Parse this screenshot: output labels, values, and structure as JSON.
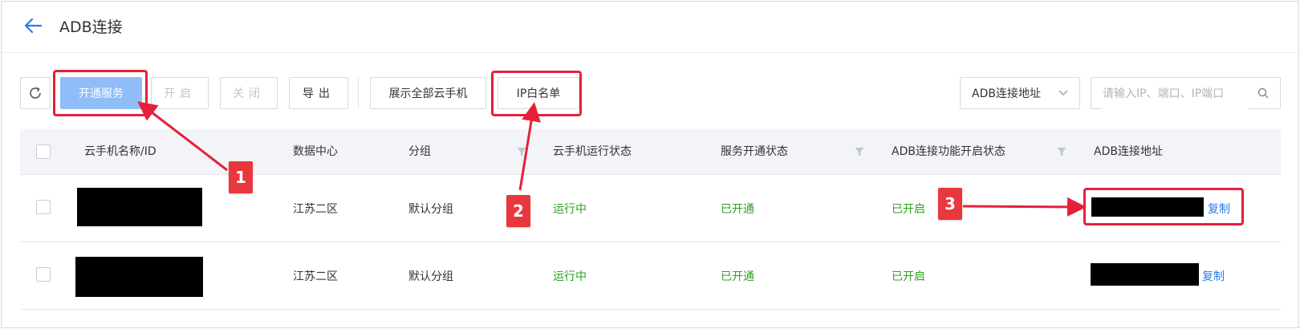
{
  "header": {
    "title": "ADB连接"
  },
  "toolbar": {
    "open_service": "开通服务",
    "enable": "开启",
    "close": "关闭",
    "export": "导出",
    "show_all": "展示全部云手机",
    "ip_whitelist": "IP白名单"
  },
  "filter": {
    "selected": "ADB连接地址"
  },
  "search": {
    "placeholder": "请输入IP、端口、IP端口"
  },
  "table": {
    "columns": {
      "name": "云手机名称/ID",
      "datacenter": "数据中心",
      "group": "分组",
      "run_status": "云手机运行状态",
      "service_status": "服务开通状态",
      "adb_status": "ADB连接功能开启状态",
      "adb_address": "ADB连接地址"
    },
    "rows": [
      {
        "datacenter": "江苏二区",
        "group": "默认分组",
        "run_status": "运行中",
        "service_status": "已开通",
        "adb_status": "已开启",
        "copy": "复制"
      },
      {
        "datacenter": "江苏二区",
        "group": "默认分组",
        "run_status": "运行中",
        "service_status": "已开通",
        "adb_status": "已开启",
        "copy": "复制"
      }
    ]
  },
  "annotations": {
    "badge1": "1",
    "badge2": "2",
    "badge3": "3"
  },
  "colors": {
    "accent": "#2c7be5",
    "status_green": "#2ea121",
    "annotation_red": "#e5203a"
  }
}
